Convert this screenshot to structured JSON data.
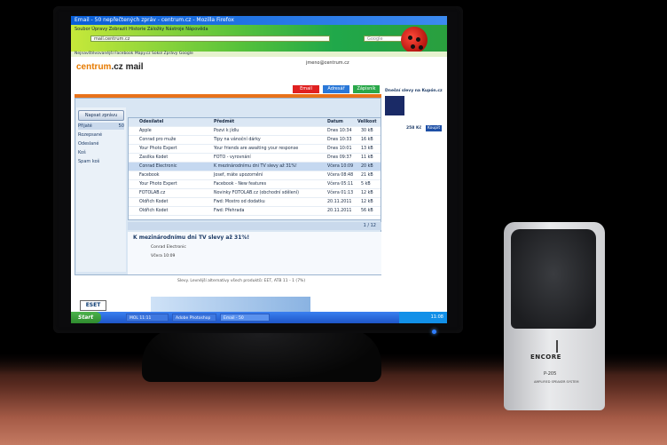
{
  "browser": {
    "window_title": "Email - 50 nepřečtených zpráv - centrum.cz - Mozilla Firefox",
    "menu": "Soubor  Úpravy  Zobrazit  Historie  Záložky  Nástroje  Nápověda",
    "url": "mail.centrum.cz",
    "search_placeholder": "Google",
    "bookmarks": "Nejnavštěvovanější  Facebook  Mapy.cz  Sokol  Zprávy Google"
  },
  "mail": {
    "logo_main": "centrum",
    "logo_suffix": ".cz mail",
    "user": "jmeno@centrum.cz",
    "tabs": [
      {
        "label": "Email",
        "color": "#e02020"
      },
      {
        "label": "Adresář",
        "color": "#2a78d8"
      },
      {
        "label": "Zápisník",
        "color": "#2aa84a"
      }
    ],
    "new_button": "Napsat zprávu",
    "folders": [
      {
        "name": "Přijaté",
        "count": "50",
        "active": true
      },
      {
        "name": "Rozepsané",
        "count": ""
      },
      {
        "name": "Odeslané",
        "count": ""
      },
      {
        "name": "Koš",
        "count": ""
      },
      {
        "name": "Spam koš",
        "count": ""
      }
    ],
    "columns": {
      "from": "Odesílatel",
      "subject": "Předmět",
      "date": "Datum",
      "size": "Velikost"
    },
    "messages": [
      {
        "from": "Apple",
        "subject": "Pozvi k jídlu",
        "date": "Dnes 10:34",
        "size": "30 kB"
      },
      {
        "from": "Conrad pro muže",
        "subject": "Tipy na vánoční dárky",
        "date": "Dnes 10:33",
        "size": "16 kB"
      },
      {
        "from": "Your Photo Expert",
        "subject": "Your friends are awaiting your response",
        "date": "Dnes 10:01",
        "size": "13 kB"
      },
      {
        "from": "Zasilka Kodet",
        "subject": "FOTO - vyrovnání",
        "date": "Dnes 09:37",
        "size": "11 kB"
      },
      {
        "from": "Conrad Electronic",
        "subject": "K mezinárodnímu dni TV slevy až 31%!",
        "date": "Včera 10:09",
        "size": "20 kB",
        "selected": true
      },
      {
        "from": "Facebook",
        "subject": "Josef, máte upozornění",
        "date": "Včera 08:48",
        "size": "21 kB"
      },
      {
        "from": "Your Photo Expert",
        "subject": "Facebook - New features",
        "date": "Včera 05:11",
        "size": "5 kB"
      },
      {
        "from": "FOTOLAB.cz",
        "subject": "Novinky FOTOLAB.cz (obchodní sdělení)",
        "date": "Včera 01:13",
        "size": "12 kB"
      },
      {
        "from": "Oldřich Kodet",
        "subject": "Fwd: Mostro od dodatku",
        "date": "20.11.2011",
        "size": "12 kB"
      },
      {
        "from": "Oldřich Kodet",
        "subject": "Fwd: Přehrada",
        "date": "20.11.2011",
        "size": "56 kB"
      }
    ],
    "pager": "1 / 12",
    "reading": {
      "subject": "K mezinárodnímu dni TV slevy až 31%!",
      "from": "Conrad Electronic",
      "date": "Včera 10:09"
    },
    "sidebar_title": "Dnešní slevy na Kupón.cz",
    "sidebar_price": "258 Kč",
    "sidebar_buy": "Koupit",
    "footer": "Slevy. Levnější alternativy všech produktů: EET, ATB 11 - 1 (7%)"
  },
  "ad_brand": "ESET",
  "taskbar": {
    "start": "Start",
    "tasks": [
      "MOL 11:11",
      "Adobe Photoshop",
      "Email - 50 nepřečtených"
    ],
    "clock": "11:08"
  },
  "speaker": {
    "brand": "ENCORE",
    "model": "P-205",
    "subtitle": "AMPLIFIED SPEAKER SYSTEM"
  }
}
